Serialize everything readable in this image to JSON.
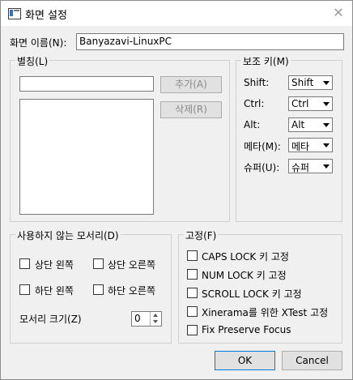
{
  "window": {
    "title": "화면 설정",
    "close_glyph": "✕"
  },
  "screen_name": {
    "label": "화면 이름(N):",
    "value": "Banyazavi-LinuxPC"
  },
  "aliases": {
    "group_title": "별칭(L)",
    "input_value": "",
    "add_label": "추가(A)",
    "remove_label": "삭제(R)",
    "items": []
  },
  "modifier_keys": {
    "group_title": "보조 키(M)",
    "rows": [
      {
        "label": "Shift:",
        "value": "Shift"
      },
      {
        "label": "Ctrl:",
        "value": "Ctrl"
      },
      {
        "label": "Alt:",
        "value": "Alt"
      },
      {
        "label": "메타(M):",
        "value": "메타"
      },
      {
        "label": "슈퍼(U):",
        "value": "슈퍼"
      }
    ]
  },
  "dead_corners": {
    "group_title": "사용하지 않는 모서리(D)",
    "top_left": "상단 왼쪽",
    "top_right": "상단 오른쪽",
    "bottom_left": "하단 왼쪽",
    "bottom_right": "하단 오른쪽",
    "corner_size_label": "모서리 크기(Z)",
    "corner_size_value": "0"
  },
  "fixes": {
    "group_title": "고정(F)",
    "items": [
      "CAPS LOCK 키 고정",
      "NUM LOCK 키 고정",
      "SCROLL LOCK 키 고정",
      "Xinerama를 위한 XTest 고정",
      "Fix Preserve Focus"
    ]
  },
  "buttons": {
    "ok": "OK",
    "cancel": "Cancel"
  }
}
